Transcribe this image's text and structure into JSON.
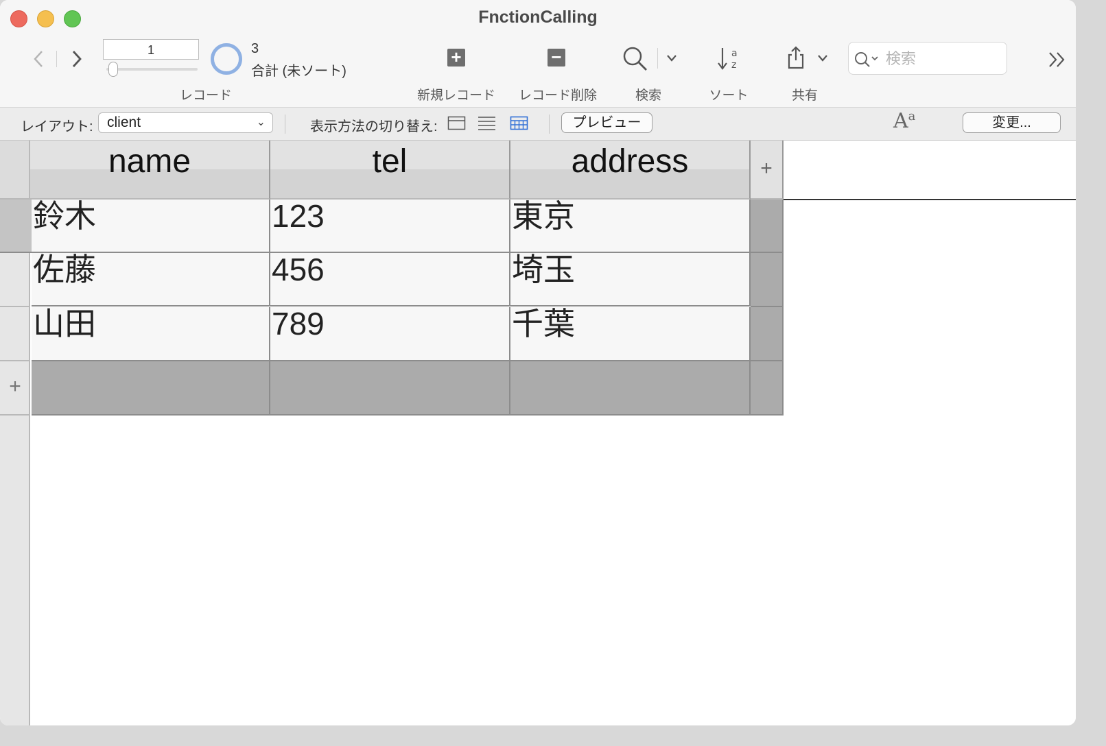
{
  "window": {
    "title": "FnctionCalling"
  },
  "toolbar": {
    "record_field_value": "1",
    "record_label": "レコード",
    "total_count": "3",
    "total_label": "合計 (未ソート)",
    "new_record_label": "新規レコード",
    "delete_record_label": "レコード削除",
    "find_label": "検索",
    "sort_label": "ソート",
    "share_label": "共有",
    "search_placeholder": "検索"
  },
  "layoutbar": {
    "layout_label": "レイアウト:",
    "layout_value": "client",
    "view_label": "表示方法の切り替え:",
    "preview_label": "プレビュー",
    "change_label": "変更..."
  },
  "table": {
    "columns": [
      "name",
      "tel",
      "address"
    ],
    "rows": [
      [
        "鈴木",
        "123",
        "東京"
      ],
      [
        "佐藤",
        "456",
        "埼玉"
      ],
      [
        "山田",
        "789",
        "千葉"
      ]
    ]
  },
  "icons": [
    "back-chevron-icon",
    "forward-chevron-icon",
    "plus-square-icon",
    "minus-square-icon",
    "magnifier-icon",
    "sort-az-icon",
    "share-icon",
    "overflow-chevrons-icon",
    "text-size-icon"
  ]
}
